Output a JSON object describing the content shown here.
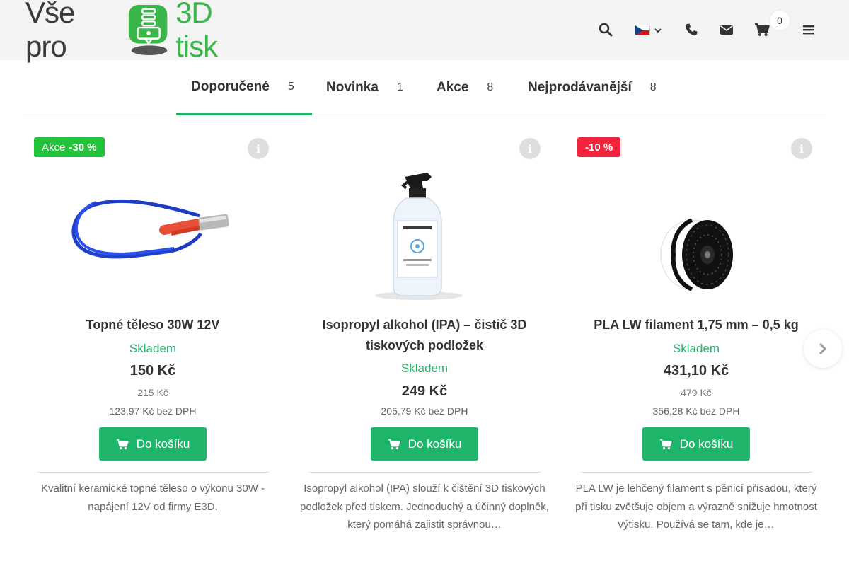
{
  "header": {
    "logo": {
      "part1": "Vše pro",
      "part2": "3D tisk"
    },
    "icons": {
      "search": "search-icon",
      "language": "czech-flag-icon",
      "phone": "phone-icon",
      "email": "envelope-icon",
      "cart": "shopping-cart-icon",
      "menu": "hamburger-menu-icon"
    },
    "cart_count": "0"
  },
  "tabs": [
    {
      "label": "Doporučené",
      "count": "5",
      "active": true
    },
    {
      "label": "Novinka",
      "count": "1",
      "active": false
    },
    {
      "label": "Akce",
      "count": "8",
      "active": false
    },
    {
      "label": "Nejprodávanější",
      "count": "8",
      "active": false
    }
  ],
  "products": [
    {
      "badge_label": "Akce",
      "badge_value": "-30 %",
      "name": "Topné těleso 30W 12V",
      "stock": "Skladem",
      "price": "150 Kč",
      "old_price": "215 Kč",
      "net_price": "123,97 Kč bez DPH",
      "button": "Do košíku",
      "description": "Kvalitní keramické topné těleso o výkonu 30W - napájení 12V od firmy E3D."
    },
    {
      "name": "Isopropyl alkohol (IPA) – čistič 3D tiskových podložek",
      "stock": "Skladem",
      "price": "249 Kč",
      "net_price": "205,79 Kč bez DPH",
      "button": "Do košíku",
      "description": "Isopropyl alkohol (IPA) slouží k čištění 3D tiskových podložek před tiskem. Jednoduchý a účinný doplněk, který pomáhá zajistit správnou…"
    },
    {
      "badge_value": "-10 %",
      "name": "PLA LW filament 1,75 mm – 0,5 kg",
      "stock": "Skladem",
      "price": "431,10 Kč",
      "old_price": "479 Kč",
      "net_price": "356,28 Kč bez DPH",
      "button": "Do košíku",
      "description": "PLA LW je lehčený filament s pěnicí přísadou, který při tisku zvětšuje objem a výrazně snižuje hmotnost výtisku. Používá se tam, kde je…"
    }
  ],
  "colors": {
    "accent": "#1fb56b",
    "badge_sale": "#22c23b",
    "badge_discount": "#f0243d",
    "header_bg": "#f4f4f4"
  }
}
